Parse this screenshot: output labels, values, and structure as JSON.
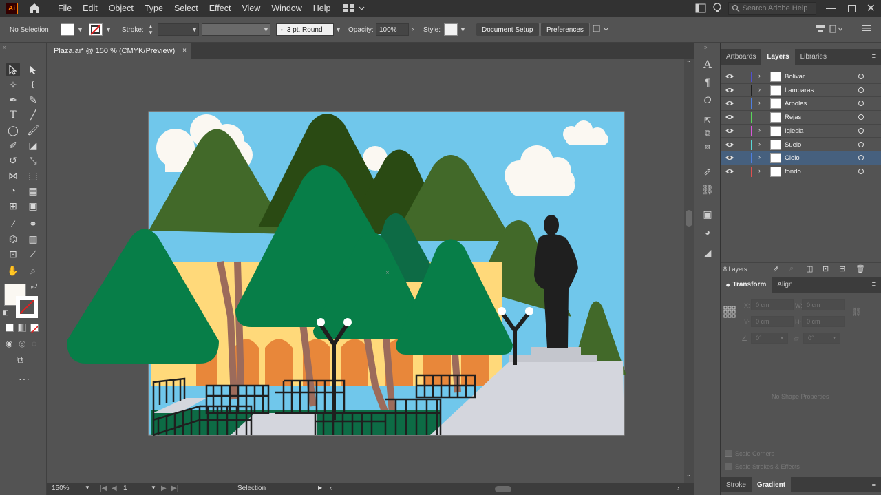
{
  "app": {
    "logo": "Ai"
  },
  "menu": [
    "File",
    "Edit",
    "Object",
    "Type",
    "Select",
    "Effect",
    "View",
    "Window",
    "Help"
  ],
  "search": {
    "placeholder": "Search Adobe Help"
  },
  "control": {
    "selection": "No Selection",
    "stroke_label": "Stroke:",
    "brush": "3 pt. Round",
    "opacity_label": "Opacity:",
    "opacity_value": "100%",
    "style_label": "Style:",
    "document_setup": "Document Setup",
    "preferences": "Preferences"
  },
  "document": {
    "tab_title": "Plaza.ai* @ 150 % (CMYK/Preview)",
    "close": "×"
  },
  "status": {
    "zoom": "150%",
    "artboard": "1",
    "tool": "Selection"
  },
  "layers_panel": {
    "tabs": [
      "Artboards",
      "Layers",
      "Libraries"
    ],
    "active_tab": "Layers",
    "layers": [
      {
        "name": "Bolivar",
        "color": "#4f4fd0",
        "expandable": true,
        "selected": false
      },
      {
        "name": "Lamparas",
        "color": "#222222",
        "expandable": true,
        "selected": false
      },
      {
        "name": "Arboles",
        "color": "#4f7fe0",
        "expandable": true,
        "selected": false
      },
      {
        "name": "Rejas",
        "color": "#59d65a",
        "expandable": false,
        "selected": false
      },
      {
        "name": "Iglesia",
        "color": "#d957d9",
        "expandable": true,
        "selected": false
      },
      {
        "name": "Suelo",
        "color": "#59d6d6",
        "expandable": true,
        "selected": false
      },
      {
        "name": "Cielo",
        "color": "#4f7fe0",
        "expandable": true,
        "selected": true
      },
      {
        "name": "fondo",
        "color": "#e05050",
        "expandable": true,
        "selected": false
      }
    ],
    "count": "8 Layers"
  },
  "transform_panel": {
    "tabs": [
      "Transform",
      "Align"
    ],
    "x_label": "X:",
    "y_label": "Y:",
    "w_label": "W:",
    "h_label": "H:",
    "x": "0 cm",
    "y": "0 cm",
    "w": "0 cm",
    "h": "0 cm",
    "rotate": "0°",
    "shear": "0°",
    "empty": "No Shape Properties",
    "scale_corners": "Scale Corners",
    "scale_strokes": "Scale Strokes & Effects"
  },
  "bottom_tabs": [
    "Stroke",
    "Gradient"
  ],
  "colors": {
    "sky": "#70c7eb",
    "fill": "#fbf8f2"
  }
}
